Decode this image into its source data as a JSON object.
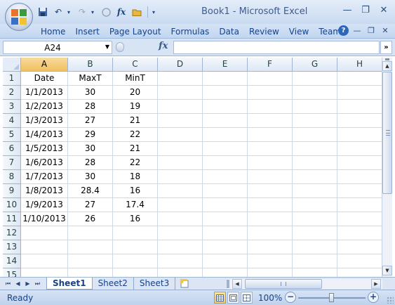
{
  "window": {
    "title": "Book1 - Microsoft Excel",
    "minimize": "—",
    "restore": "❐",
    "close": "✕"
  },
  "quick_access": {
    "save": "💾",
    "undo": "↶",
    "redo": "↷",
    "fx": "fx",
    "open": "📂",
    "customize": "▾"
  },
  "ribbon_tabs": [
    "Home",
    "Insert",
    "Page Layout",
    "Formulas",
    "Data",
    "Review",
    "View",
    "Team"
  ],
  "ribbon_controls": {
    "help": "?",
    "minimize": "—",
    "restore": "❐",
    "close": "✕"
  },
  "formula_bar": {
    "name_box": "A24",
    "fx_label": "fx",
    "content": "",
    "expand": "»"
  },
  "columns": [
    "A",
    "B",
    "C",
    "D",
    "E",
    "F",
    "G",
    "H"
  ],
  "active_column": "A",
  "rows": [
    {
      "n": "1",
      "cells": [
        "Date",
        "MaxT",
        "MinT"
      ]
    },
    {
      "n": "2",
      "cells": [
        "1/1/2013",
        "30",
        "20"
      ]
    },
    {
      "n": "3",
      "cells": [
        "1/2/2013",
        "28",
        "19"
      ]
    },
    {
      "n": "4",
      "cells": [
        "1/3/2013",
        "27",
        "21"
      ]
    },
    {
      "n": "5",
      "cells": [
        "1/4/2013",
        "29",
        "22"
      ]
    },
    {
      "n": "6",
      "cells": [
        "1/5/2013",
        "30",
        "21"
      ]
    },
    {
      "n": "7",
      "cells": [
        "1/6/2013",
        "28",
        "22"
      ]
    },
    {
      "n": "8",
      "cells": [
        "1/7/2013",
        "30",
        "18"
      ]
    },
    {
      "n": "9",
      "cells": [
        "1/8/2013",
        "28.4",
        "16"
      ]
    },
    {
      "n": "10",
      "cells": [
        "1/9/2013",
        "27",
        "17.4"
      ]
    },
    {
      "n": "11",
      "cells": [
        "1/10/2013",
        "26",
        "16"
      ]
    },
    {
      "n": "12",
      "cells": [
        "",
        "",
        ""
      ]
    },
    {
      "n": "13",
      "cells": [
        "",
        "",
        ""
      ]
    },
    {
      "n": "14",
      "cells": [
        "",
        "",
        ""
      ]
    },
    {
      "n": "15",
      "cells": [
        "",
        "",
        ""
      ]
    }
  ],
  "sheet_nav": [
    "⏮",
    "◀",
    "▶",
    "⏭"
  ],
  "sheets": [
    "Sheet1",
    "Sheet2",
    "Sheet3"
  ],
  "active_sheet": "Sheet1",
  "status": {
    "text": "Ready",
    "zoom": "100%",
    "zoom_fraction": 0.5,
    "zoom_minus": "−",
    "zoom_plus": "+"
  },
  "scroll": {
    "up": "▲",
    "down": "▼",
    "left": "◀",
    "right": "▶"
  },
  "colors": {
    "accent": "#15428b",
    "active_header": "#f5c65a",
    "gridline": "#d0d7e5"
  }
}
